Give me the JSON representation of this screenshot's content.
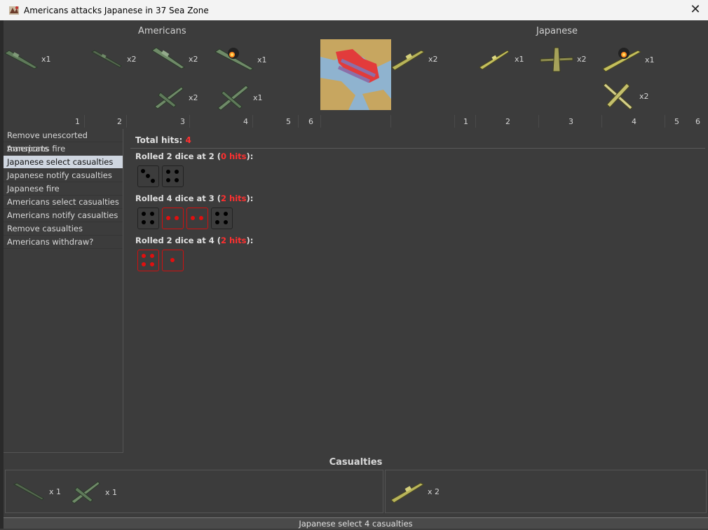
{
  "window": {
    "title": "Americans attacks Japanese in 37 Sea Zone"
  },
  "header": {
    "attacker": "Americans",
    "defender": "Japanese",
    "attacker_units": [
      {
        "icon": "us-transport-icon",
        "count": "x1"
      },
      {
        "icon": "us-submarine-icon",
        "count": "x2"
      },
      {
        "icon": "us-cruiser-icon",
        "count": "x2"
      },
      {
        "icon": "us-damaged-battleship-icon",
        "count": "x1"
      },
      {
        "icon": "us-fighter-icon",
        "count": "x2"
      },
      {
        "icon": "us-bomber-icon",
        "count": "x1"
      }
    ],
    "defender_units": [
      {
        "icon": "jp-transport-icon",
        "count": "x2"
      },
      {
        "icon": "jp-destroyer-icon",
        "count": "x1"
      },
      {
        "icon": "jp-bomber-icon",
        "count": "x2"
      },
      {
        "icon": "jp-damaged-battleship-icon",
        "count": "x1"
      },
      {
        "icon": "jp-fighter-icon",
        "count": "x2"
      }
    ],
    "attacker_columns": [
      "1",
      "2",
      "3",
      "4",
      "5",
      "6"
    ],
    "defender_columns": [
      "1",
      "2",
      "3",
      "4",
      "5",
      "6"
    ]
  },
  "steps": [
    "Remove unescorted transports",
    "Americans fire",
    "Japanese select casualties",
    "Japanese notify casualties",
    "Japanese fire",
    "Americans select casualties",
    "Americans notify casualties",
    "Remove casualties",
    "Americans withdraw?"
  ],
  "selected_step": 2,
  "results": {
    "total_label": "Total hits:",
    "total_value": "4",
    "rolls": [
      {
        "pre": "Rolled 2 dice at 2 (",
        "hits": "0 hits",
        "post": "):",
        "dice": [
          {
            "v": 3,
            "hit": false
          },
          {
            "v": 4,
            "hit": false
          }
        ]
      },
      {
        "pre": "Rolled 4 dice at 3 (",
        "hits": "2 hits",
        "post": "):",
        "dice": [
          {
            "v": 4,
            "hit": false
          },
          {
            "v": 2,
            "hit": true
          },
          {
            "v": 2,
            "hit": true
          },
          {
            "v": 4,
            "hit": false
          }
        ]
      },
      {
        "pre": "Rolled 2 dice at 4 (",
        "hits": "2 hits",
        "post": "):",
        "dice": [
          {
            "v": 4,
            "hit": true
          },
          {
            "v": 1,
            "hit": true
          }
        ]
      }
    ]
  },
  "casualties": {
    "title": "Casualties",
    "left": [
      {
        "icon": "us-submarine-icon",
        "count": "x 1"
      },
      {
        "icon": "us-fighter-icon",
        "count": "x 1"
      }
    ],
    "right": [
      {
        "icon": "jp-transport-icon",
        "count": "x 2"
      }
    ]
  },
  "status": "Japanese select 4 casualties",
  "colors": {
    "hit_red": "#ff3030",
    "us_unit": "#5f7a5a",
    "jp_unit": "#b8b45a",
    "selected_step_bg": "#cfd6e0"
  }
}
